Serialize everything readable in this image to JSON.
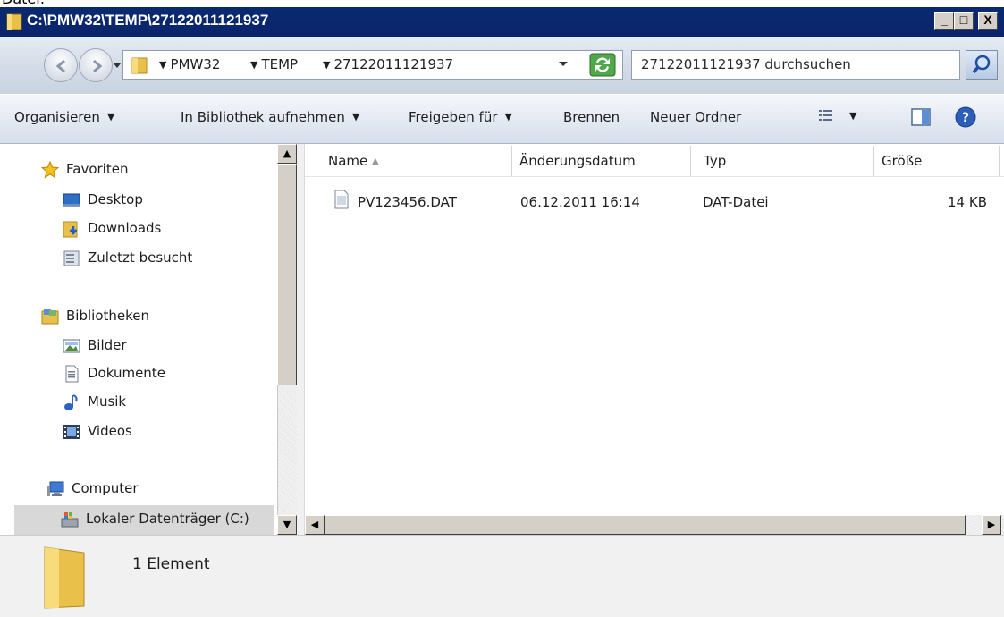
{
  "caption": "Datei:",
  "window": {
    "title": "C:\\PMW32\\TEMP\\27122011121937",
    "min_label": "_",
    "max_label": "□",
    "close_label": "X"
  },
  "address": {
    "crumbs": [
      "PMW32",
      "TEMP",
      "27122011121937"
    ],
    "search_placeholder": "27122011121937 durchsuchen"
  },
  "toolbar": {
    "organize": "Organisieren",
    "library": "In Bibliothek aufnehmen",
    "share": "Freigeben für",
    "burn": "Brennen",
    "new_folder": "Neuer Ordner"
  },
  "nav": {
    "favorites": "Favoriten",
    "desktop": "Desktop",
    "downloads": "Downloads",
    "recent": "Zuletzt besucht",
    "libraries": "Bibliotheken",
    "pictures": "Bilder",
    "documents": "Dokumente",
    "music": "Musik",
    "videos": "Videos",
    "computer": "Computer",
    "local_disk": "Lokaler Datenträger (C:)"
  },
  "columns": {
    "name": "Name",
    "date": "Änderungsdatum",
    "type": "Typ",
    "size": "Größe"
  },
  "files": [
    {
      "name": "PV123456.DAT",
      "date": "06.12.2011 16:14",
      "type": "DAT-Datei",
      "size": "14 KB"
    }
  ],
  "status": {
    "count": "1 Element"
  },
  "colors": {
    "titlebar": "#0a246a",
    "selection": "#d8d8d8",
    "toolbar_gradient_top": "#f5f7fb"
  }
}
